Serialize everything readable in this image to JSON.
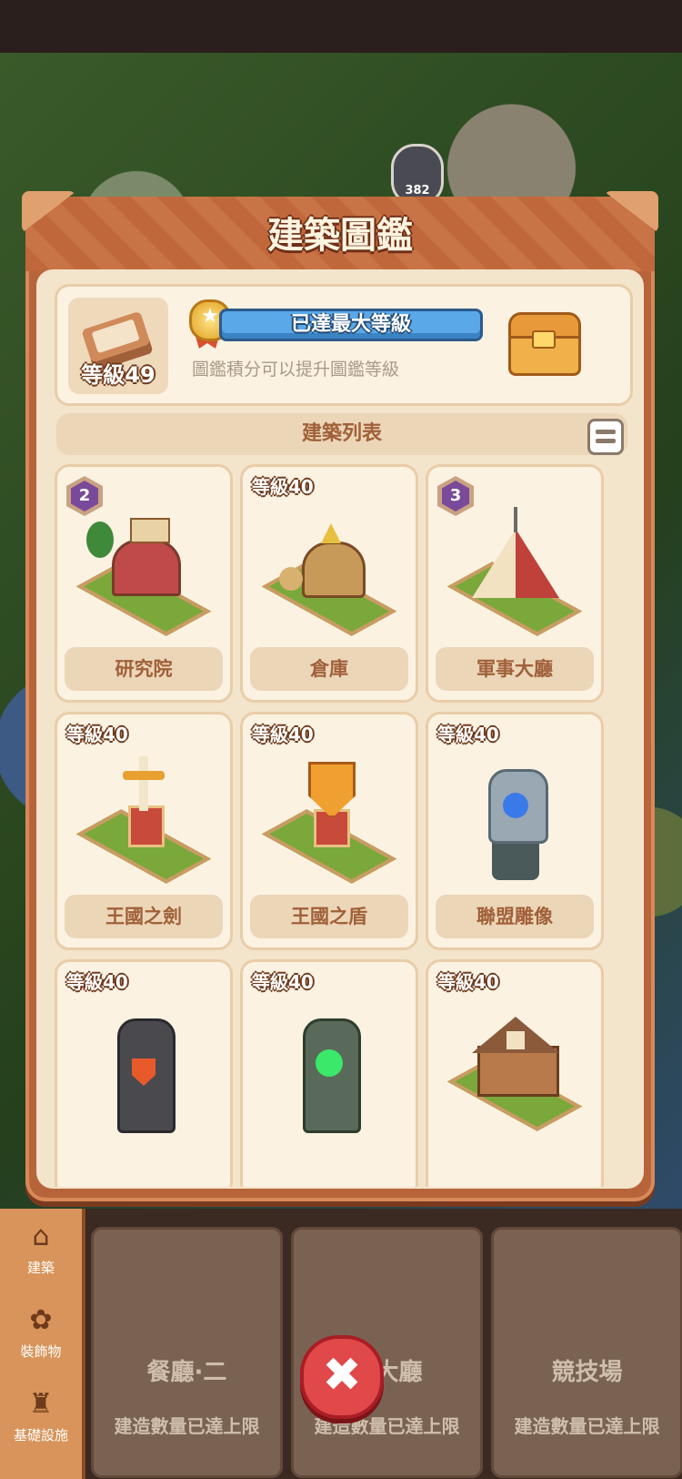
{
  "hud": {
    "hero_level": "382"
  },
  "modal": {
    "title": "建築圖鑑",
    "level_card": {
      "level_label": "等級49",
      "progress_text": "已達最大等級",
      "progress_fraction": 1.0,
      "hint": "圖鑑積分可以提升圖鑑等級"
    },
    "list_title": "建築列表",
    "buildings": [
      {
        "badge": "2",
        "name": "研究院"
      },
      {
        "badge": "等級40",
        "name": "倉庫"
      },
      {
        "badge": "3",
        "name": "軍事大廳"
      },
      {
        "badge": "等級40",
        "name": "王國之劍"
      },
      {
        "badge": "等級40",
        "name": "王國之盾"
      },
      {
        "badge": "等級40",
        "name": "聯盟雕像"
      },
      {
        "badge": "等級40",
        "name": ""
      },
      {
        "badge": "等級40",
        "name": ""
      },
      {
        "badge": "等級40",
        "name": ""
      }
    ]
  },
  "sidebar": {
    "items": [
      {
        "label": "建築",
        "icon": "house-icon"
      },
      {
        "label": "裝飾物",
        "icon": "flower-icon"
      },
      {
        "label": "基礎設施",
        "icon": "castle-icon"
      }
    ]
  },
  "build_cards": [
    {
      "name": "餐廳·二",
      "status": "建造數量已達上限"
    },
    {
      "name": "王大廳",
      "status": "建造數量已達上限"
    },
    {
      "name": "競技場",
      "status": "建造數量已達上限"
    }
  ],
  "close_button": {
    "glyph": "✖"
  }
}
